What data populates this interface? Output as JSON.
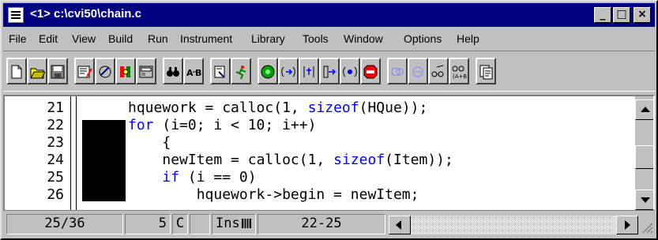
{
  "window": {
    "title": "<1> c:\\cvi50\\chain.c",
    "controls": {
      "minimize": "_",
      "maximize": "□",
      "close": "×"
    }
  },
  "menu": {
    "items": [
      "File",
      "Edit",
      "View",
      "Build",
      "Run",
      "Instrument",
      "Library",
      "Tools",
      "Window",
      "Options",
      "Help"
    ]
  },
  "toolbar": {
    "buttons": [
      "new-file-icon",
      "open-file-icon",
      "save-file-icon",
      "edit-icon",
      "tool-icon",
      "function-panel-icon",
      "panel-icon",
      "find-icon",
      "replace-icon",
      "reference-icon",
      "run-icon",
      "go-icon",
      "step-into-icon",
      "step-over-icon",
      "finish-function-icon",
      "breakpoint-icon",
      "stop-icon",
      "watch-icon",
      "variables-icon",
      "view-variable-icon",
      "expression-icon",
      "clipboard-icon"
    ]
  },
  "editor": {
    "line_numbers": [
      "21",
      "22",
      "23",
      "24",
      "25",
      "26"
    ],
    "lines": [
      {
        "indent": "",
        "pre": "hquework = calloc(1, ",
        "kw": "sizeof",
        "post": "(HQue));"
      },
      {
        "indent": "",
        "pre": "",
        "kw": "for",
        "post": " (i=0; i < 10; i++)"
      },
      {
        "indent": "    ",
        "pre": "{",
        "kw": "",
        "post": ""
      },
      {
        "indent": "    ",
        "pre": "newItem = calloc(1, ",
        "kw": "sizeof",
        "post": "(Item));"
      },
      {
        "indent": "    ",
        "pre": "",
        "kw": "if",
        "post": " (i == 0)"
      },
      {
        "indent": "        ",
        "pre": "hquework->begin = newItem;",
        "kw": "",
        "post": ""
      }
    ]
  },
  "status": {
    "position": "25/36",
    "column": "5",
    "col_mode": "C",
    "blank": "",
    "insert_mode": "Ins",
    "selection": "22-25"
  }
}
